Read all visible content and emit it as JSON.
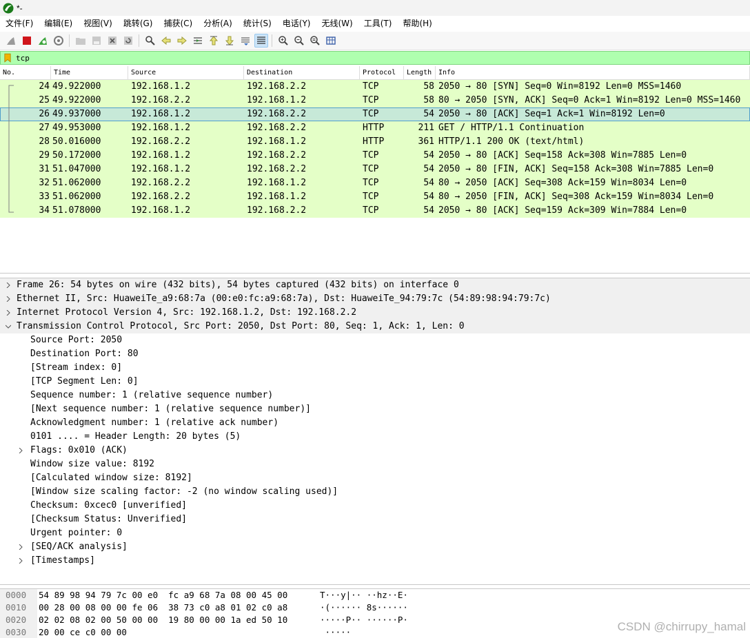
{
  "window": {
    "title": "*-"
  },
  "menu": [
    "文件(F)",
    "编辑(E)",
    "视图(V)",
    "跳转(G)",
    "捕获(C)",
    "分析(A)",
    "统计(S)",
    "电话(Y)",
    "无线(W)",
    "工具(T)",
    "帮助(H)"
  ],
  "toolbar": {
    "icons": [
      "shark-fin-start-icon",
      "stop-capture-icon",
      "restart-capture-icon",
      "capture-options-icon",
      "open-file-icon",
      "save-file-icon",
      "close-file-icon",
      "reload-file-icon",
      "find-packet-icon",
      "go-back-icon",
      "go-forward-icon",
      "go-to-packet-icon",
      "go-first-icon",
      "go-last-icon",
      "autoscroll-icon",
      "colorize-icon",
      "zoom-in-icon",
      "zoom-out-icon",
      "zoom-normal-icon",
      "resize-columns-icon"
    ]
  },
  "filter": {
    "value": "tcp"
  },
  "packet_list": {
    "columns": [
      "No.",
      "Time",
      "Source",
      "Destination",
      "Protocol",
      "Length",
      "Info"
    ],
    "rows": [
      {
        "no": "24",
        "time": "49.922000",
        "src": "192.168.1.2",
        "dst": "192.168.2.2",
        "proto": "TCP",
        "len": "58",
        "info": "2050 → 80 [SYN] Seq=0 Win=8192 Len=0 MSS=1460"
      },
      {
        "no": "25",
        "time": "49.922000",
        "src": "192.168.2.2",
        "dst": "192.168.1.2",
        "proto": "TCP",
        "len": "58",
        "info": "80 → 2050 [SYN, ACK] Seq=0 Ack=1 Win=8192 Len=0 MSS=1460"
      },
      {
        "no": "26",
        "time": "49.937000",
        "src": "192.168.1.2",
        "dst": "192.168.2.2",
        "proto": "TCP",
        "len": "54",
        "info": "2050 → 80 [ACK] Seq=1 Ack=1 Win=8192 Len=0"
      },
      {
        "no": "27",
        "time": "49.953000",
        "src": "192.168.1.2",
        "dst": "192.168.2.2",
        "proto": "HTTP",
        "len": "211",
        "info": "GET / HTTP/1.1 Continuation"
      },
      {
        "no": "28",
        "time": "50.016000",
        "src": "192.168.2.2",
        "dst": "192.168.1.2",
        "proto": "HTTP",
        "len": "361",
        "info": "HTTP/1.1 200 OK  (text/html)"
      },
      {
        "no": "29",
        "time": "50.172000",
        "src": "192.168.1.2",
        "dst": "192.168.2.2",
        "proto": "TCP",
        "len": "54",
        "info": "2050 → 80 [ACK] Seq=158 Ack=308 Win=7885 Len=0"
      },
      {
        "no": "31",
        "time": "51.047000",
        "src": "192.168.1.2",
        "dst": "192.168.2.2",
        "proto": "TCP",
        "len": "54",
        "info": "2050 → 80 [FIN, ACK] Seq=158 Ack=308 Win=7885 Len=0"
      },
      {
        "no": "32",
        "time": "51.062000",
        "src": "192.168.2.2",
        "dst": "192.168.1.2",
        "proto": "TCP",
        "len": "54",
        "info": "80 → 2050 [ACK] Seq=308 Ack=159 Win=8034 Len=0"
      },
      {
        "no": "33",
        "time": "51.062000",
        "src": "192.168.2.2",
        "dst": "192.168.1.2",
        "proto": "TCP",
        "len": "54",
        "info": "80 → 2050 [FIN, ACK] Seq=308 Ack=159 Win=8034 Len=0"
      },
      {
        "no": "34",
        "time": "51.078000",
        "src": "192.168.1.2",
        "dst": "192.168.2.2",
        "proto": "TCP",
        "len": "54",
        "info": "2050 → 80 [ACK] Seq=159 Ack=309 Win=7884 Len=0"
      }
    ],
    "selected_no": "26"
  },
  "details": {
    "frame": "Frame 26: 54 bytes on wire (432 bits), 54 bytes captured (432 bits) on interface 0",
    "ethernet": "Ethernet II, Src: HuaweiTe_a9:68:7a (00:e0:fc:a9:68:7a), Dst: HuaweiTe_94:79:7c (54:89:98:94:79:7c)",
    "ip": "Internet Protocol Version 4, Src: 192.168.1.2, Dst: 192.168.2.2",
    "tcp": "Transmission Control Protocol, Src Port: 2050, Dst Port: 80, Seq: 1, Ack: 1, Len: 0",
    "tcp_fields": {
      "src_port": "Source Port: 2050",
      "dst_port": "Destination Port: 80",
      "stream_index": "[Stream index: 0]",
      "seg_len": "[TCP Segment Len: 0]",
      "seq": "Sequence number: 1    (relative sequence number)",
      "next_seq": "[Next sequence number: 1    (relative sequence number)]",
      "ack": "Acknowledgment number: 1    (relative ack number)",
      "hdr_len": "0101 .... = Header Length: 20 bytes (5)",
      "flags": "Flags: 0x010 (ACK)",
      "win": "Window size value: 8192",
      "calc_win": "[Calculated window size: 8192]",
      "win_scale": "[Window size scaling factor: -2 (no window scaling used)]",
      "checksum": "Checksum: 0xcec0 [unverified]",
      "checksum_status": "[Checksum Status: Unverified]",
      "urgent": "Urgent pointer: 0",
      "seq_ack": "[SEQ/ACK analysis]",
      "timestamps": "[Timestamps]"
    }
  },
  "hex": {
    "rows": [
      {
        "offset": "0000",
        "bytes": "54 89 98 94 79 7c 00 e0  fc a9 68 7a 08 00 45 00",
        "ascii": "T···y|·· ··hz··E·"
      },
      {
        "offset": "0010",
        "bytes": "00 28 00 08 00 00 fe 06  38 73 c0 a8 01 02 c0 a8",
        "ascii": "·(······ 8s······"
      },
      {
        "offset": "0020",
        "bytes": "02 02 08 02 00 50 00 00  19 80 00 00 1a ed 50 10",
        "ascii": "·····P·· ······P·"
      },
      {
        "offset": "0030",
        "bytes": "20 00 ce c0 00 00",
        "ascii": " ·····"
      }
    ]
  },
  "watermark": "CSDN @chirrupy_hamal",
  "colors": {
    "tcp_row": "#e4ffc7",
    "selected_row": "#c7e9d8",
    "filter_bg": "#afffaf"
  }
}
